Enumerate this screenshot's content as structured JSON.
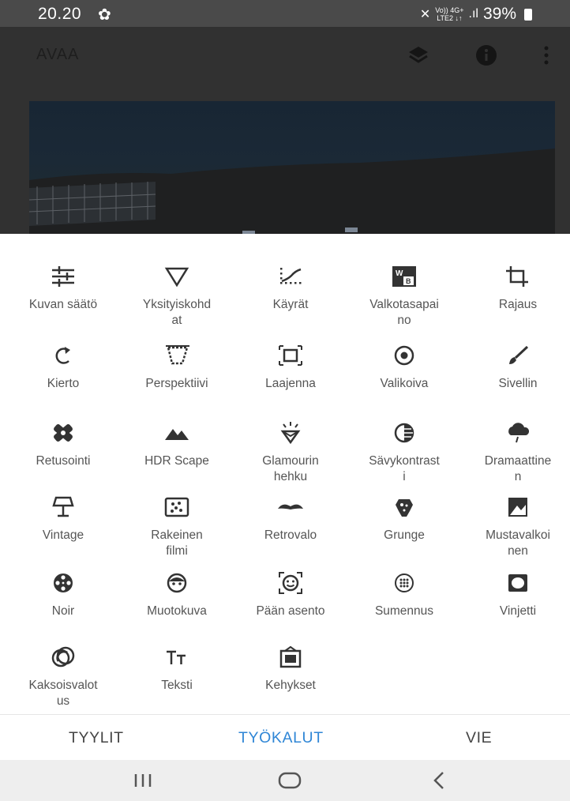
{
  "status": {
    "time": "20.20",
    "net_top": "Vo)) 4G+",
    "net_bottom": "LTE2 ↓↑",
    "battery": "39%"
  },
  "appbar": {
    "title": "AVAA"
  },
  "tools": [
    {
      "label": "Kuvan säätö",
      "icon": "tune-icon"
    },
    {
      "label": "Yksityiskohd\nat",
      "icon": "details-triangle-icon"
    },
    {
      "label": "Käyrät",
      "icon": "curves-icon"
    },
    {
      "label": "Valkotasapai\nno",
      "icon": "white-balance-icon"
    },
    {
      "label": "Rajaus",
      "icon": "crop-icon"
    },
    {
      "label": "Kierto",
      "icon": "rotate-icon"
    },
    {
      "label": "Perspektiivi",
      "icon": "perspective-icon"
    },
    {
      "label": "Laajenna",
      "icon": "expand-icon"
    },
    {
      "label": "Valikoiva",
      "icon": "selective-icon"
    },
    {
      "label": "Sivellin",
      "icon": "brush-icon"
    },
    {
      "label": "Retusointi",
      "icon": "healing-icon"
    },
    {
      "label": "HDR Scape",
      "icon": "hdr-mountains-icon"
    },
    {
      "label": "Glamourin\nhehku",
      "icon": "glamour-glow-icon"
    },
    {
      "label": "Sävykontrast\ni",
      "icon": "tonal-contrast-icon"
    },
    {
      "label": "Dramaattine\nn",
      "icon": "drama-cloud-icon"
    },
    {
      "label": "Vintage",
      "icon": "vintage-lamp-icon"
    },
    {
      "label": "Rakeinen\nfilmi",
      "icon": "grainy-film-icon"
    },
    {
      "label": "Retrovalo",
      "icon": "mustache-icon"
    },
    {
      "label": "Grunge",
      "icon": "grunge-icon"
    },
    {
      "label": "Mustavalkoi\nnen",
      "icon": "black-white-icon"
    },
    {
      "label": "Noir",
      "icon": "film-reel-icon"
    },
    {
      "label": "Muotokuva",
      "icon": "portrait-face-icon"
    },
    {
      "label": "Pään asento",
      "icon": "head-pose-icon"
    },
    {
      "label": "Sumennus",
      "icon": "lens-blur-icon"
    },
    {
      "label": "Vinjetti",
      "icon": "vignette-icon"
    },
    {
      "label": "Kaksoisvalot\nus",
      "icon": "double-exposure-icon"
    },
    {
      "label": "Teksti",
      "icon": "text-icon"
    },
    {
      "label": "Kehykset",
      "icon": "frames-icon"
    }
  ],
  "tabs": {
    "styles": "TYYLIT",
    "tools": "TYÖKALUT",
    "export": "VIE",
    "active_color": "#2f86d6"
  }
}
